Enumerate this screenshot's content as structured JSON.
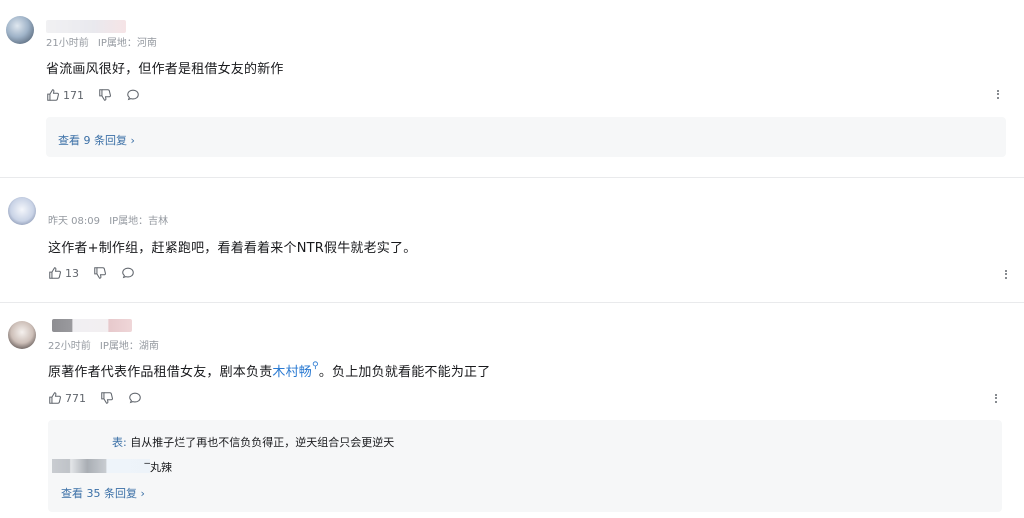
{
  "comments": [
    {
      "time": "21小时前",
      "ip": "IP属地：河南",
      "text": "省流画风很好，但作者是租借女友的新作",
      "likes": "171",
      "view_replies": "查看 9 条回复",
      "chevron": "›"
    },
    {
      "time": "昨天 08:09",
      "ip": "IP属地：吉林",
      "text": "这作者+制作组，赶紧跑吧，看着看着来个NTR假牛就老实了。",
      "likes": "13"
    },
    {
      "time": "22小时前",
      "ip": "IP属地：湖南",
      "text_before": "原著作者代表作品租借女友，剧本负责",
      "link": "木村畅",
      "search_glyph": "⚲",
      "text_after": "。负上加负就看能不能为正了",
      "likes": "771",
      "sub_reply_author_suffix": "表:",
      "sub_reply_text": "自从推子烂了再也不信负负得正，逆天组合只会更逆天",
      "sub_reply2_suffix": "̅丸辣",
      "view_replies": "查看 35 条回复",
      "chevron": "›"
    }
  ],
  "colors": {
    "meta": "#9499a0",
    "link": "#2a7ad2",
    "reply_bg": "#f6f7f8",
    "view_more": "#3a6fa6"
  },
  "icons": [
    "thumb-up-icon",
    "thumb-down-icon",
    "reply-bubble-icon",
    "more-vertical-icon",
    "search-icon",
    "chevron-right-icon"
  ]
}
